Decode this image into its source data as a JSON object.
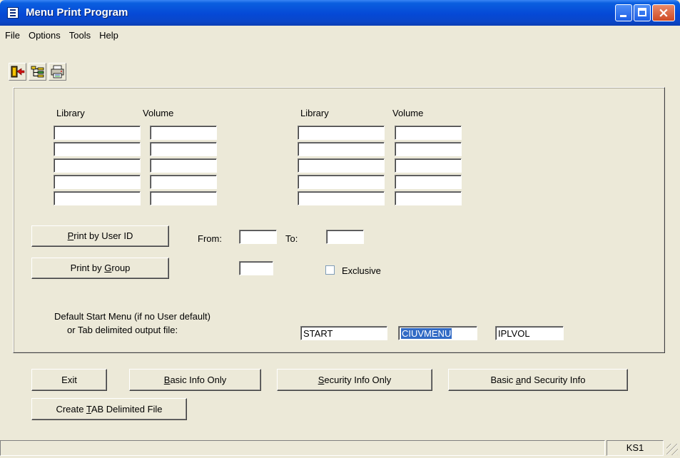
{
  "window": {
    "title": "Menu Print Program",
    "title_icon": "window-icon"
  },
  "menubar": {
    "items": [
      "File",
      "Options",
      "Tools",
      "Help"
    ]
  },
  "toolbar": {
    "items": [
      "exit-icon",
      "tree-icon",
      "print-icon"
    ]
  },
  "panel": {
    "left_group": {
      "library_label": "Library",
      "volume_label": "Volume",
      "rows": [
        {
          "library": "",
          "volume": ""
        },
        {
          "library": "",
          "volume": ""
        },
        {
          "library": "",
          "volume": ""
        },
        {
          "library": "",
          "volume": ""
        },
        {
          "library": "",
          "volume": ""
        }
      ]
    },
    "right_group": {
      "library_label": "Library",
      "volume_label": "Volume",
      "rows": [
        {
          "library": "",
          "volume": ""
        },
        {
          "library": "",
          "volume": ""
        },
        {
          "library": "",
          "volume": ""
        },
        {
          "library": "",
          "volume": ""
        },
        {
          "library": "",
          "volume": ""
        }
      ]
    },
    "print_by_user_id": {
      "pre": "",
      "key": "P",
      "post": "rint by User ID"
    },
    "print_by_group": {
      "pre": "Print by ",
      "key": "G",
      "post": "roup"
    },
    "from_label": "From:",
    "from_value": "",
    "to_label": "To:",
    "to_value": "",
    "group_value": "",
    "exclusive_label": "Exclusive",
    "exclusive_checked": false,
    "default_menu_line1": "Default Start Menu (if no User default)",
    "default_menu_line2": "or Tab delimited output file:",
    "start_value": "START",
    "menu_value": "CIUVMENU",
    "volume_value": "IPLVOL"
  },
  "buttons": {
    "exit": {
      "pre": "Exit",
      "key": "",
      "post": ""
    },
    "basic_info": {
      "pre": "",
      "key": "B",
      "post": "asic Info Only"
    },
    "security_info": {
      "pre": "",
      "key": "S",
      "post": "ecurity Info Only"
    },
    "basic_and_security": {
      "pre": "Basic ",
      "key": "a",
      "post": "nd Security Info"
    },
    "create_tab": {
      "pre": "Create ",
      "key": "T",
      "post": "AB Delimited File"
    }
  },
  "status": {
    "left": "",
    "right": "KS1"
  },
  "colors": {
    "titlebar": "#0549d6",
    "background": "#ece9d8",
    "selection": "#316ac5"
  }
}
